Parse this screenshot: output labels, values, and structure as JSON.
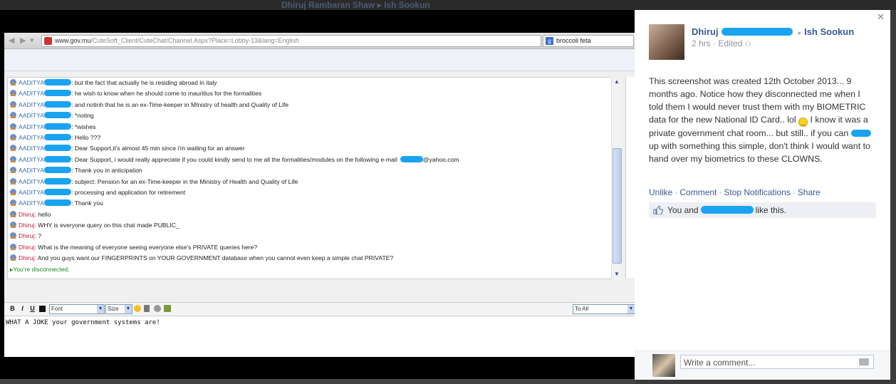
{
  "background": {
    "names": "Dhiruj Rambaran Shaw",
    "arrow": "▸",
    "target": "Ish Sookun"
  },
  "browser": {
    "url_domain": "www.gov.mu",
    "url_path": "/CuteSoft_Client/CuteChat/Channel.Aspx?Place=Lobby-13&lang=English",
    "search_value": "broccoli feta"
  },
  "chat": {
    "messages": [
      {
        "user": "AADITYA",
        "text": "but the fact that actually he is residing abroad in italy",
        "type": "a"
      },
      {
        "user": "AADITYA",
        "text": "he wish to know when he should come to mauritius for the formalities",
        "type": "a"
      },
      {
        "user": "AADITYA",
        "text": "and notinh that he is an ex-Time-keeper in MInistry of health and Quality of Life",
        "type": "a"
      },
      {
        "user": "AADITYA",
        "text": "*noting",
        "type": "a"
      },
      {
        "user": "AADITYA",
        "text": "*wishes",
        "type": "a"
      },
      {
        "user": "AADITYA",
        "text": "Hello ???",
        "type": "a"
      },
      {
        "user": "AADITYA",
        "text": "Dear Support,it's almost 45 min since i'm waiting for an answer",
        "type": "a"
      },
      {
        "user": "AADITYA",
        "text": "Dear Support, i would really appreciate if you could kindly send to me all the formalities/modules on the following e-mail",
        "suffix": "@yahoo.com",
        "type": "a"
      },
      {
        "user": "AADITYA",
        "text": "Thank you in anticipation",
        "type": "a"
      },
      {
        "user": "AADITYA",
        "text": "subject: Pension for an ex-Time-keeper in the Ministry of Health and Quality of Life",
        "type": "a"
      },
      {
        "user": "AADITYA",
        "text": "processing and application for retirement",
        "type": "a"
      },
      {
        "user": "AADITYA",
        "text": "Thank you",
        "type": "a"
      },
      {
        "user": "Dhiruj:",
        "text": "hello",
        "type": "d"
      },
      {
        "user": "Dhiruj:",
        "text": "WHY is everyone query on this chat made PUBLIC_",
        "type": "d"
      },
      {
        "user": "Dhiruj:",
        "text": "?",
        "type": "d"
      },
      {
        "user": "Dhiruj:",
        "text": "What is the meaning of everyone seeing everyone else's PRIVATE queries here?",
        "type": "d"
      },
      {
        "user": "Dhiruj:",
        "text": "And you guys want our FINGERPRINTS on YOUR GOVERNMENT database when you cannot even keep a simple chat PRIVATE?",
        "type": "d"
      }
    ],
    "system_message": "You're disconnected.",
    "format_bar": {
      "bold": "B",
      "italic": "I",
      "underline": "U",
      "font_select": "Font",
      "size_select": "Size",
      "recipient_select": "To All"
    },
    "input_text": "WHAT A JOKE your government systems are!"
  },
  "post": {
    "author": "Dhiruj",
    "arrow": "▸",
    "target": "Ish Sookun",
    "time": "2 hrs",
    "edited": "Edited",
    "body_1": "This screenshot was created 12th October 2013... 9 months ago. Notice how they disconnected me when I told them I would never trust them with my BIOMETRIC data for the new National ID Card.. lol",
    "body_2": "I know it was a private government chat room... but still.. if you can",
    "body_3": "up with something this simple, don't think I would want to hand over my biometrics to these CLOWNS.",
    "actions": [
      "Unlike",
      "Comment",
      "Stop Notifications",
      "Share"
    ],
    "likes_prefix": "You and",
    "likes_suffix": "like this.",
    "comment_placeholder": "Write a comment..."
  }
}
